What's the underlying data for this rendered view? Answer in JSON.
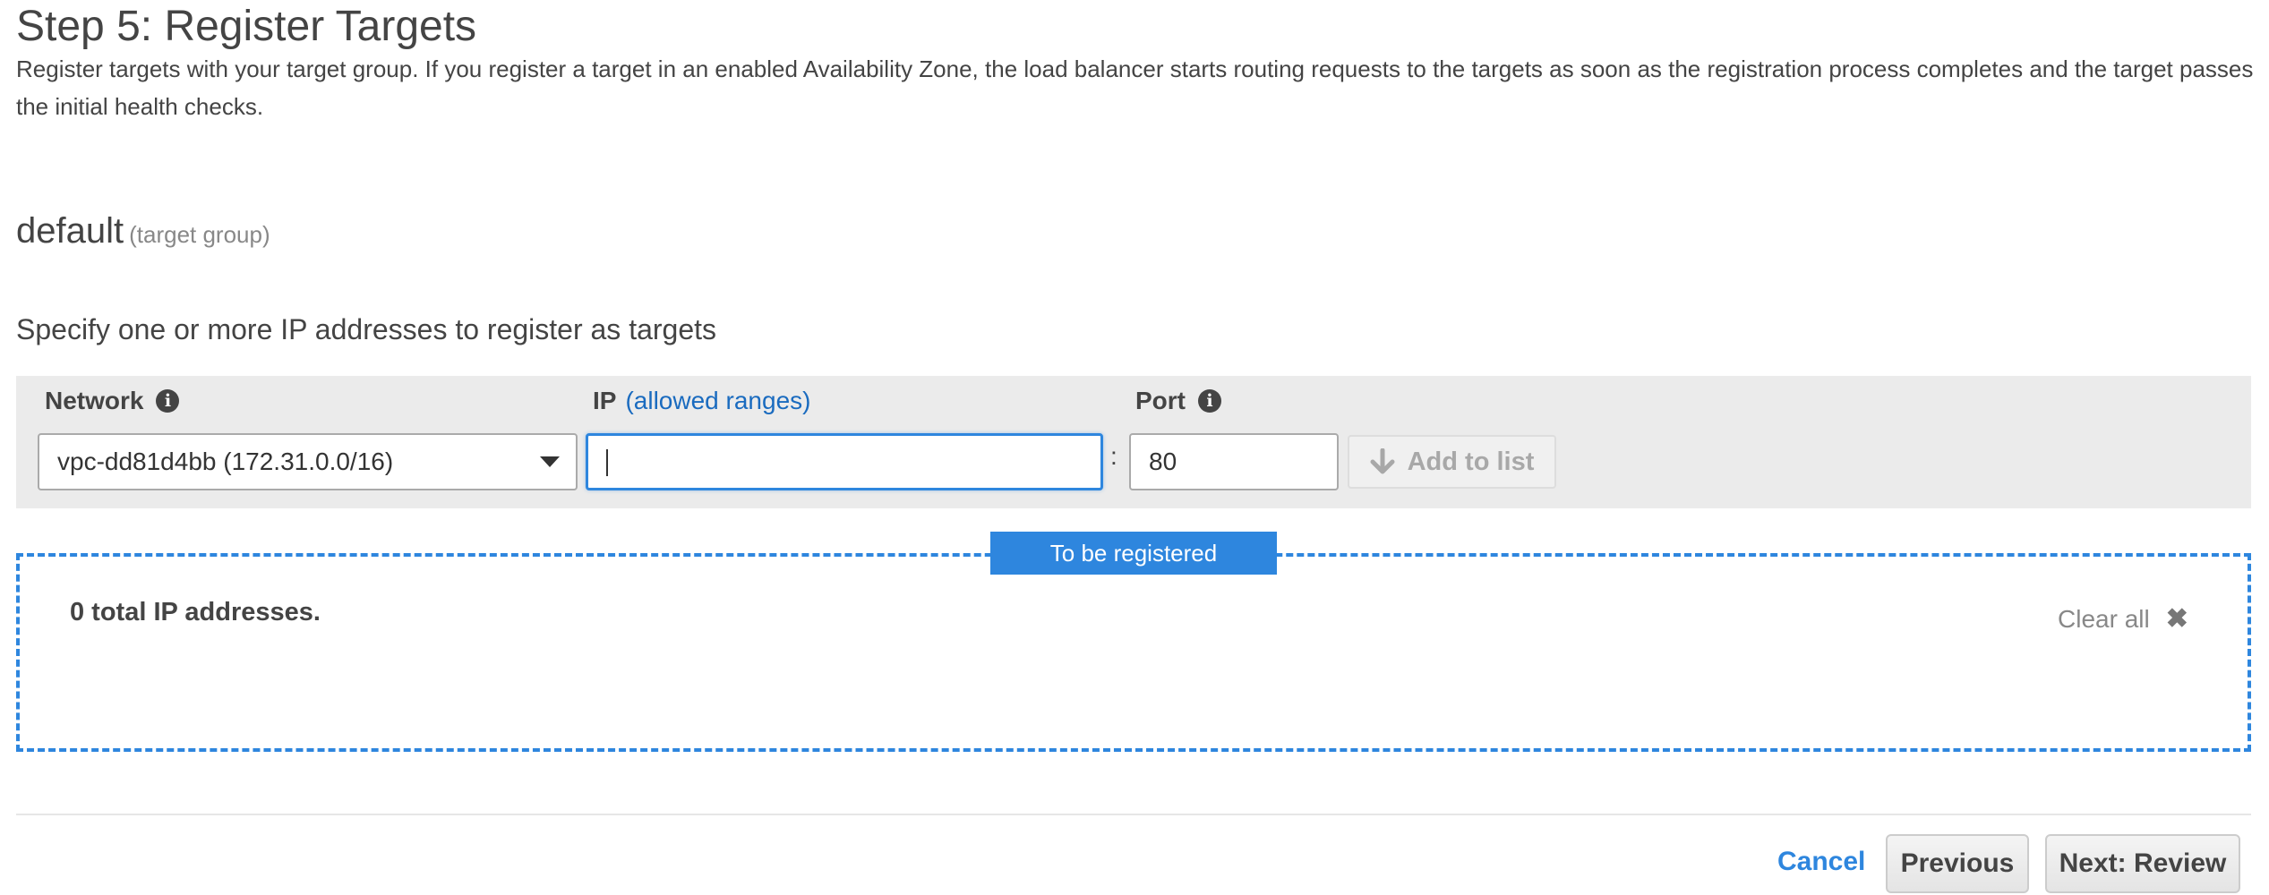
{
  "step": {
    "title": "Step 5: Register Targets",
    "description": "Register targets with your target group. If you register a target in an enabled Availability Zone, the load balancer starts routing requests to the targets as soon as the registration process completes and the target passes the initial health checks."
  },
  "target_group": {
    "name": "default",
    "suffix": "(target group)"
  },
  "specify_text": "Specify one or more IP addresses to register as targets",
  "form": {
    "network_label": "Network",
    "network_value": "vpc-dd81d4bb (172.31.0.0/16)",
    "ip_label": "IP",
    "ip_link": "(allowed ranges)",
    "ip_value": "",
    "separator": ":",
    "port_label": "Port",
    "port_value": "80",
    "add_button": "Add to list"
  },
  "registered": {
    "tab_label": "To be registered",
    "total_text": "0 total IP addresses.",
    "clear_all": "Clear all"
  },
  "footer": {
    "cancel": "Cancel",
    "previous": "Previous",
    "next": "Next: Review"
  },
  "colors": {
    "accent": "#2e86de",
    "link": "#1a6bbf",
    "panel": "#ebebeb"
  },
  "icons": {
    "info": "info-circle-icon",
    "dropdown": "caret-down-icon",
    "add": "arrow-down-icon",
    "clear": "close-x-icon"
  }
}
